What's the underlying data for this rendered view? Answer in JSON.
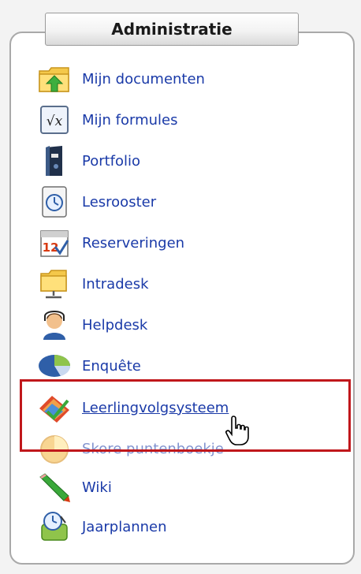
{
  "panel": {
    "title": "Administratie",
    "items": [
      {
        "label": "Mijn documenten",
        "icon": "folder-upload-icon"
      },
      {
        "label": "Mijn formules",
        "icon": "formula-icon"
      },
      {
        "label": "Portfolio",
        "icon": "binder-icon"
      },
      {
        "label": "Lesrooster",
        "icon": "clock-icon"
      },
      {
        "label": "Reserveringen",
        "icon": "calendar-icon"
      },
      {
        "label": "Intradesk",
        "icon": "network-folder-icon"
      },
      {
        "label": "Helpdesk",
        "icon": "support-agent-icon"
      },
      {
        "label": "Enquête",
        "icon": "pie-chart-icon"
      },
      {
        "label": "Leerlingvolgsysteem",
        "icon": "tracking-icon",
        "state": "hover"
      },
      {
        "label": "Skore puntenboekje",
        "icon": "score-icon",
        "state": "partially-hidden"
      },
      {
        "label": "Wiki",
        "icon": "pencil-icon"
      },
      {
        "label": "Jaarplannen",
        "icon": "planner-icon"
      }
    ]
  },
  "colors": {
    "link": "#1a3aa8",
    "highlight_border": "#c0171b",
    "panel_border": "#a9a9a9"
  }
}
